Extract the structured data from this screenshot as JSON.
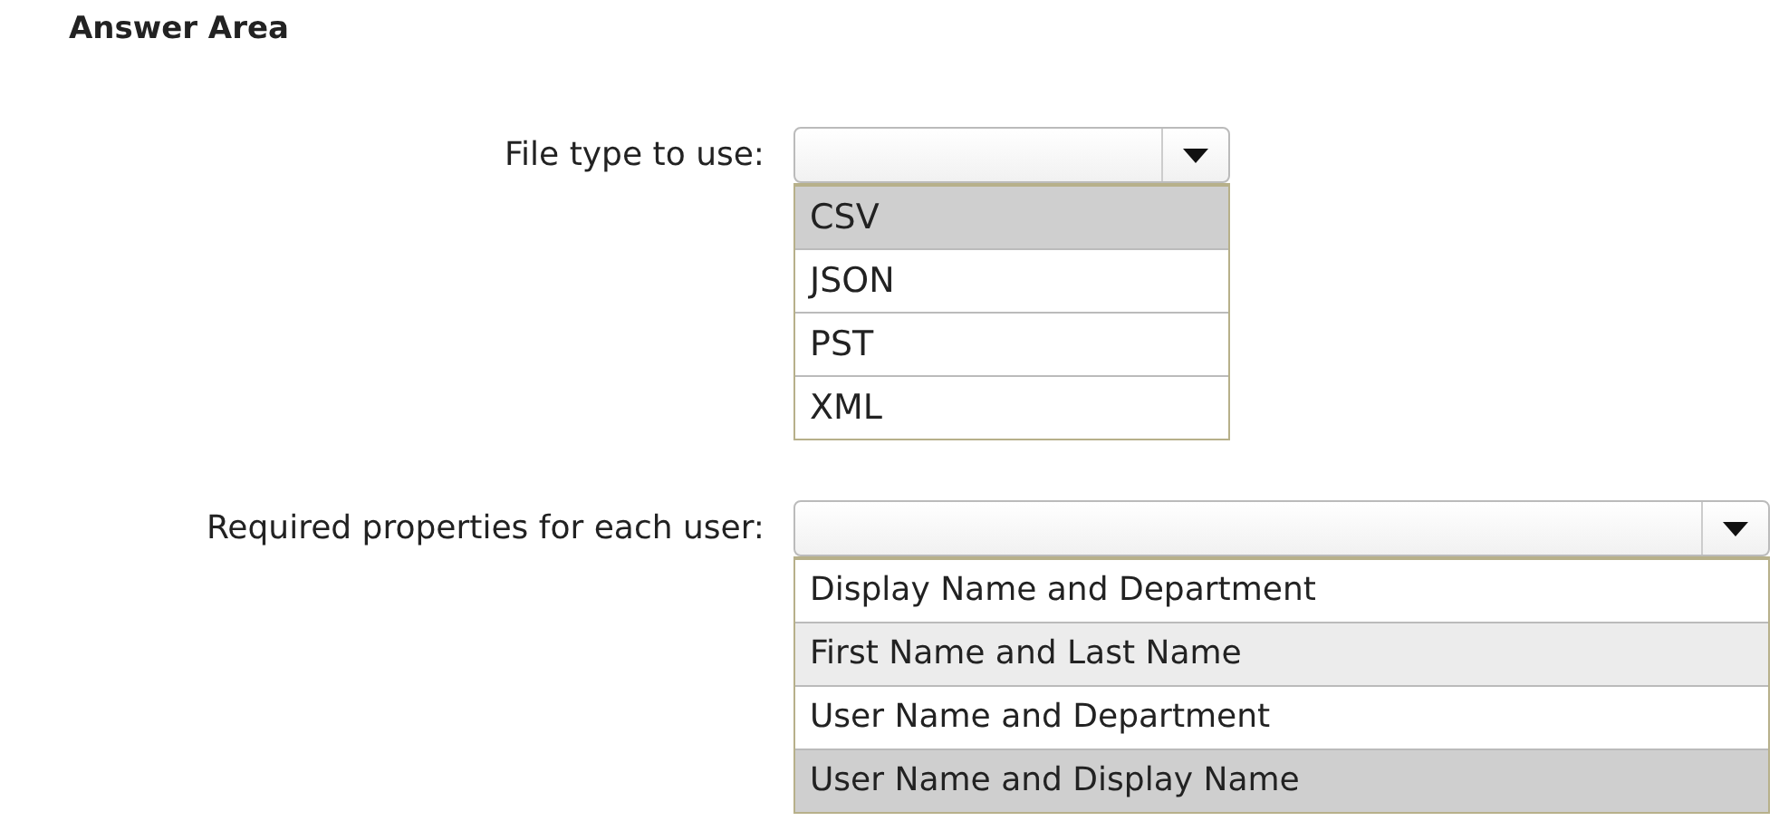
{
  "title": "Answer Area",
  "questions": [
    {
      "label": "File type to use:",
      "options": [
        {
          "text": "CSV",
          "selected": true,
          "hover": false
        },
        {
          "text": "JSON",
          "selected": false,
          "hover": false
        },
        {
          "text": "PST",
          "selected": false,
          "hover": false
        },
        {
          "text": "XML",
          "selected": false,
          "hover": false
        }
      ]
    },
    {
      "label": "Required properties for each user:",
      "options": [
        {
          "text": "Display Name and Department",
          "selected": false,
          "hover": false
        },
        {
          "text": "First Name and Last Name",
          "selected": false,
          "hover": true
        },
        {
          "text": "User Name and Department",
          "selected": false,
          "hover": false
        },
        {
          "text": "User Name and Display Name",
          "selected": true,
          "hover": false
        }
      ]
    }
  ]
}
